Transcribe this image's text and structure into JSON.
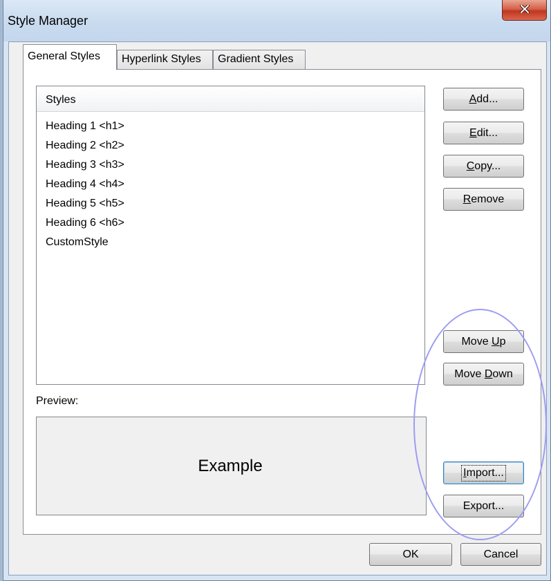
{
  "window": {
    "title": "Style Manager",
    "close_icon": "close-icon"
  },
  "tabs": [
    {
      "label": "General Styles",
      "active": true
    },
    {
      "label": "Hyperlink Styles",
      "active": false
    },
    {
      "label": "Gradient Styles",
      "active": false
    }
  ],
  "styles_list": {
    "header": "Styles",
    "items": [
      "Heading 1 <h1>",
      "Heading 2 <h2>",
      "Heading 3 <h3>",
      "Heading 4 <h4>",
      "Heading 5 <h5>",
      "Heading 6 <h6>",
      "CustomStyle"
    ]
  },
  "buttons": {
    "add": {
      "prefix": "",
      "mnemonic": "A",
      "suffix": "dd..."
    },
    "edit": {
      "prefix": "",
      "mnemonic": "E",
      "suffix": "dit..."
    },
    "copy": {
      "prefix": "",
      "mnemonic": "C",
      "suffix": "opy..."
    },
    "remove": {
      "prefix": "",
      "mnemonic": "R",
      "suffix": "emove"
    },
    "move_up": {
      "prefix": "Move ",
      "mnemonic": "U",
      "suffix": "p"
    },
    "move_down": {
      "prefix": "Move ",
      "mnemonic": "D",
      "suffix": "own"
    },
    "import": {
      "prefix": "",
      "mnemonic": "I",
      "suffix": "mport..."
    },
    "export": {
      "prefix": "Export...",
      "mnemonic": "",
      "suffix": ""
    },
    "ok": "OK",
    "cancel": "Cancel"
  },
  "preview": {
    "label": "Preview:",
    "sample_text": "Example"
  },
  "annotation": {
    "color": "#9c9cf4"
  }
}
